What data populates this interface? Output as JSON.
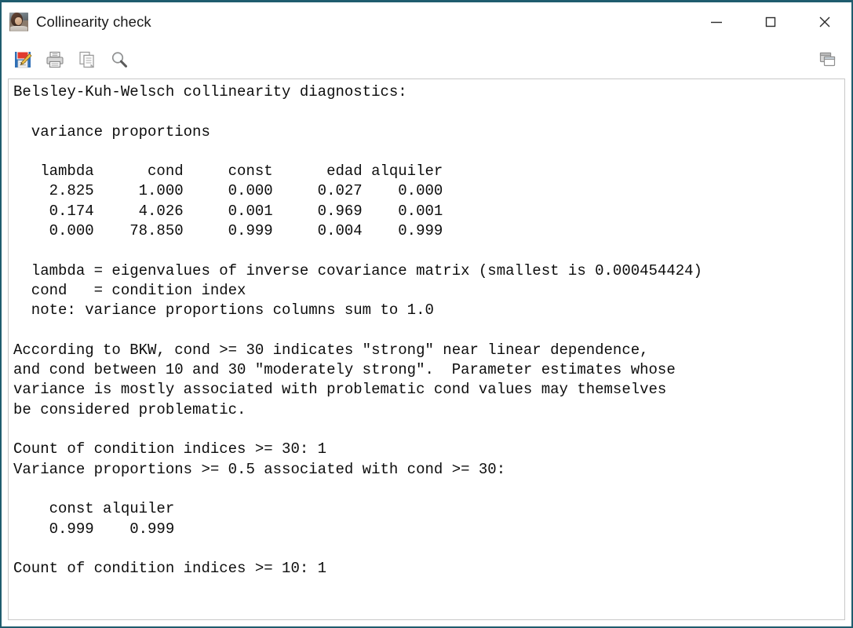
{
  "window": {
    "title": "Collinearity check",
    "app_icon": "gretl-photo-icon",
    "accent_border": "#1f5c6e",
    "controls": {
      "minimize": "minimize",
      "maximize": "maximize",
      "close": "close"
    }
  },
  "toolbar": {
    "left_items": [
      {
        "name": "save-icon",
        "tooltip": "Save"
      },
      {
        "name": "print-icon",
        "tooltip": "Print"
      },
      {
        "name": "copy-icon",
        "tooltip": "Copy"
      },
      {
        "name": "find-icon",
        "tooltip": "Find"
      }
    ],
    "right_items": [
      {
        "name": "windows-list-icon",
        "tooltip": "Windows"
      }
    ]
  },
  "report": {
    "heading": "Belsley-Kuh-Welsch collinearity diagnostics:",
    "section_label": "variance proportions",
    "table": {
      "headers": [
        "lambda",
        "cond",
        "const",
        "edad",
        "alquiler"
      ],
      "rows": [
        [
          "2.825",
          "1.000",
          "0.000",
          "0.027",
          "0.000"
        ],
        [
          "0.174",
          "4.026",
          "0.001",
          "0.969",
          "0.001"
        ],
        [
          "0.000",
          "78.850",
          "0.999",
          "0.004",
          "0.999"
        ]
      ]
    },
    "legend": [
      "lambda = eigenvalues of inverse covariance matrix (smallest is 0.000454424)",
      "cond   = condition index",
      "note: variance proportions columns sum to 1.0"
    ],
    "explanation": [
      "According to BKW, cond >= 30 indicates \"strong\" near linear dependence,",
      "and cond between 10 and 30 \"moderately strong\".  Parameter estimates whose",
      "variance is mostly associated with problematic cond values may themselves",
      "be considered problematic."
    ],
    "count_30": "Count of condition indices >= 30: 1",
    "assoc_30_label": "Variance proportions >= 0.5 associated with cond >= 30:",
    "assoc_30_headers": [
      "const",
      "alquiler"
    ],
    "assoc_30_values": [
      "0.999",
      "0.999"
    ],
    "count_10": "Count of condition indices >= 10: 1",
    "full_text": "Belsley-Kuh-Welsch collinearity diagnostics:\n\n  variance proportions\n\n   lambda      cond     const      edad alquiler\n    2.825     1.000     0.000     0.027    0.000\n    0.174     4.026     0.001     0.969    0.001\n    0.000    78.850     0.999     0.004    0.999\n\n  lambda = eigenvalues of inverse covariance matrix (smallest is 0.000454424)\n  cond   = condition index\n  note: variance proportions columns sum to 1.0\n\nAccording to BKW, cond >= 30 indicates \"strong\" near linear dependence,\nand cond between 10 and 30 \"moderately strong\".  Parameter estimates whose\nvariance is mostly associated with problematic cond values may themselves\nbe considered problematic.\n\nCount of condition indices >= 30: 1\nVariance proportions >= 0.5 associated with cond >= 30:\n\n    const alquiler\n    0.999    0.999\n\nCount of condition indices >= 10: 1"
  }
}
